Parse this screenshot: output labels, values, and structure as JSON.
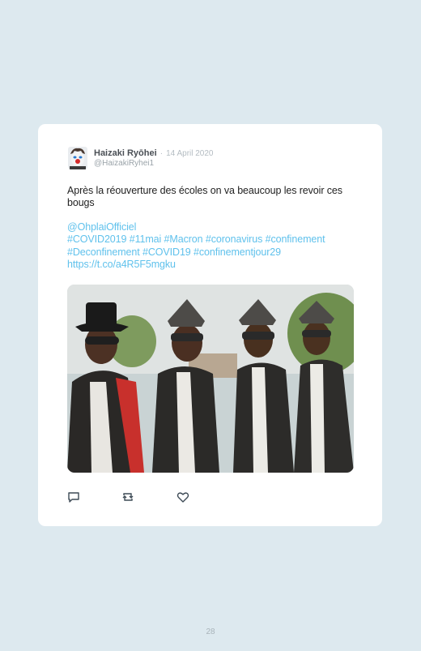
{
  "tweet": {
    "author_name": "Haizaki Ryōhei",
    "separator": "·",
    "date": "14 April 2020",
    "handle": "@HaizakiRyhei1",
    "text": "Après la réouverture des écoles on va beaucoup les revoir ces bougs",
    "tag_lines": [
      "@OhplaiOfficiel",
      "#COVID2019 #11mai #Macron #coronavirus #confinement",
      "#Deconfinement #COVID19 #confinementjour29",
      "https://t.co/a4R5F5mgku"
    ]
  },
  "actions": {
    "icons": [
      "reply-icon",
      "retweet-icon",
      "like-icon"
    ]
  },
  "colors": {
    "background": "#dde9ef",
    "card": "#ffffff",
    "link": "#5fc1ec"
  },
  "page_number": "28"
}
